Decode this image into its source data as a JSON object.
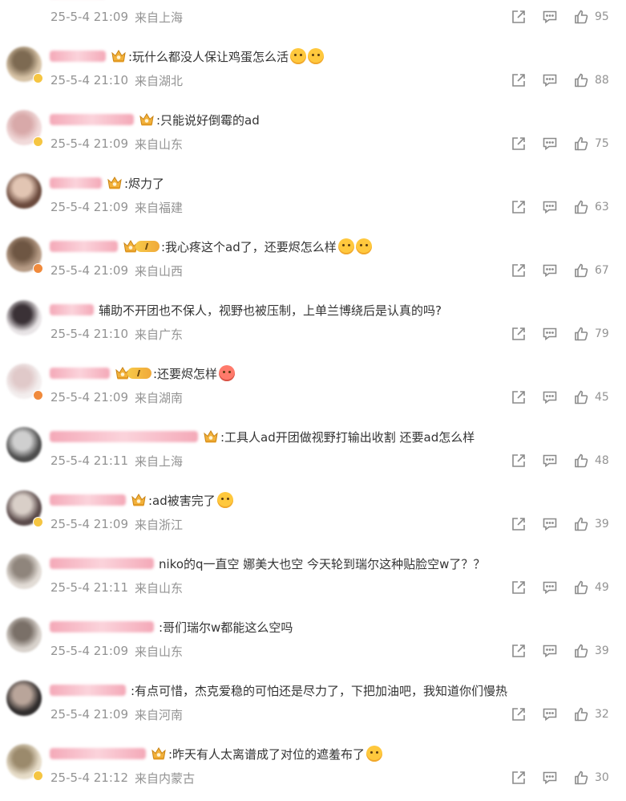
{
  "comments": [
    {
      "vip": "crown",
      "text": "",
      "emojis": [],
      "date": "25-5-4 21:09",
      "location": "来自上海",
      "likes": "95",
      "colors": [
        "#c9b8a5",
        "#8e7a66"
      ],
      "badge": ""
    },
    {
      "vip": "crown",
      "text": ":玩什么都没人保让鸡蛋怎么活",
      "emojis": [
        "sweat-emoji",
        "sweat-emoji"
      ],
      "date": "25-5-4 21:10",
      "location": "来自湖北",
      "likes": "88",
      "colors": [
        "#d7c3a6",
        "#7d6a52"
      ],
      "badge": "#f5c542"
    },
    {
      "vip": "crown",
      "text": ":只能说好倒霉的ad",
      "emojis": [],
      "date": "25-5-4 21:09",
      "location": "来自山东",
      "likes": "75",
      "colors": [
        "#f1dada",
        "#d8a9a9"
      ],
      "badge": "#f5c542"
    },
    {
      "vip": "crown",
      "text": ":烬力了",
      "emojis": [],
      "date": "25-5-4 21:09",
      "location": "来自福建",
      "likes": "63",
      "colors": [
        "#6b4a3d",
        "#e2c5b3"
      ],
      "badge": ""
    },
    {
      "vip": "crown-level",
      "text": ":我心疼这个ad了，还要烬怎么样",
      "emojis": [
        "hug-emoji",
        "hug-emoji"
      ],
      "date": "25-5-4 21:09",
      "location": "来自山西",
      "likes": "67",
      "colors": [
        "#b69b85",
        "#6e5643"
      ],
      "badge": "#f08a3c"
    },
    {
      "vip": "",
      "text": "辅助不开团也不保人，视野也被压制，上单兰博绕后是认真的吗?",
      "emojis": [],
      "date": "25-5-4 21:10",
      "location": "来自广东",
      "likes": "79",
      "colors": [
        "#e8e4e6",
        "#3a3136"
      ],
      "badge": ""
    },
    {
      "vip": "crown-level",
      "text": ":还要烬怎样",
      "emojis": [
        "red-emoji"
      ],
      "date": "25-5-4 21:09",
      "location": "来自湖南",
      "likes": "45",
      "colors": [
        "#f3eeee",
        "#e0c9c9"
      ],
      "badge": "#f08a3c"
    },
    {
      "vip": "crown",
      "text": ":工具人ad开团做视野打输出收割 还要ad怎么样",
      "emojis": [],
      "date": "25-5-4 21:11",
      "location": "来自上海",
      "likes": "48",
      "colors": [
        "#4d4d4d",
        "#cfcfcf"
      ],
      "badge": ""
    },
    {
      "vip": "crown",
      "text": ":ad被害完了",
      "emojis": [
        "laugh-emoji"
      ],
      "date": "25-5-4 21:09",
      "location": "来自浙江",
      "likes": "39",
      "colors": [
        "#5a4a4a",
        "#d9cfc8"
      ],
      "badge": "#f5c542"
    },
    {
      "vip": "",
      "text": "niko的q一直空  娜美大也空 今天轮到瑞尔这种贴脸空w了？？",
      "emojis": [],
      "date": "25-5-4 21:11",
      "location": "来自山东",
      "likes": "49",
      "colors": [
        "#e2dcd6",
        "#8f857c"
      ],
      "badge": ""
    },
    {
      "vip": "",
      "text": ":哥们瑞尔w都能这么空吗",
      "emojis": [],
      "date": "25-5-4 21:09",
      "location": "来自山东",
      "likes": "39",
      "colors": [
        "#d8d2cc",
        "#7a7068"
      ],
      "badge": ""
    },
    {
      "vip": "",
      "text": ":有点可惜，杰克爱稳的可怕还是尽力了，下把加油吧，我知道你们慢热",
      "emojis": [],
      "date": "25-5-4 21:09",
      "location": "来自河南",
      "likes": "32",
      "colors": [
        "#2f2c2c",
        "#b9a59a"
      ],
      "badge": ""
    },
    {
      "vip": "crown",
      "text": ":昨天有人太离谱成了对位的遮羞布了",
      "emojis": [
        "laugh-emoji"
      ],
      "date": "25-5-4 21:12",
      "location": "来自内蒙古",
      "likes": "30",
      "colors": [
        "#e6dcc8",
        "#9b8a6c"
      ],
      "badge": "#f5c542"
    }
  ],
  "name_widths": [
    70,
    70,
    105,
    65,
    85,
    55,
    75,
    185,
    95,
    130,
    130,
    95,
    120
  ],
  "icons": {
    "share": "share-icon",
    "reply": "comment-icon",
    "like": "thumbs-up-icon"
  },
  "colors": {
    "text": "#333333",
    "meta": "#939393",
    "icon": "#8a8a8a",
    "name_blur": "#f4a9b8"
  }
}
